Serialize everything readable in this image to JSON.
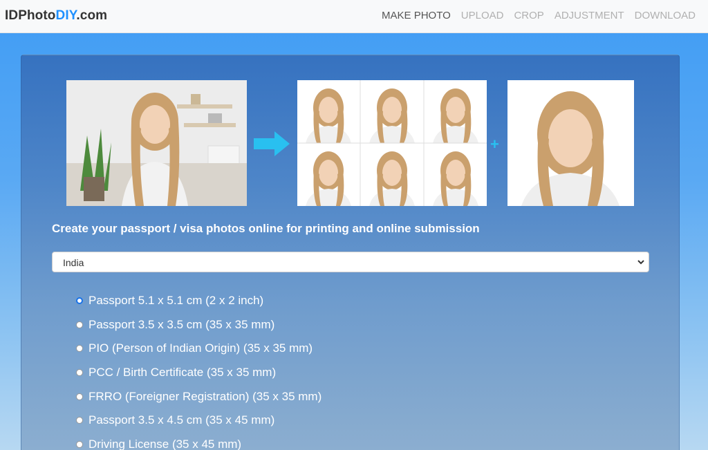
{
  "brand": {
    "part1": "IDPhoto",
    "part2": "DIY",
    "part3": ".com"
  },
  "nav": {
    "items": [
      {
        "label": "MAKE PHOTO"
      },
      {
        "label": "UPLOAD"
      },
      {
        "label": "CROP"
      },
      {
        "label": "ADJUSTMENT"
      },
      {
        "label": "DOWNLOAD"
      }
    ]
  },
  "main": {
    "plus": "+",
    "headline": "Create your passport / visa photos online for printing and online submission",
    "country_select": {
      "value": "India"
    },
    "options": [
      {
        "label": "Passport 5.1 x 5.1 cm (2 x 2 inch)",
        "checked": true
      },
      {
        "label": "Passport 3.5 x 3.5 cm (35 x 35 mm)"
      },
      {
        "label": "PIO (Person of Indian Origin) (35 x 35 mm)"
      },
      {
        "label": "PCC / Birth Certificate (35 x 35 mm)"
      },
      {
        "label": "FRRO (Foreigner Registration) (35 x 35 mm)"
      },
      {
        "label": "Passport 3.5 x 4.5 cm (35 x 45 mm)"
      },
      {
        "label": "Driving License (35 x 45 mm)"
      }
    ]
  },
  "colors": {
    "accent": "#1e90ff",
    "arrow": "#29c0f0",
    "radio_checked": "#1a73e8"
  },
  "icons": [
    "right-arrow-icon",
    "plus-icon",
    "chevron-down-icon",
    "radio-icon"
  ]
}
